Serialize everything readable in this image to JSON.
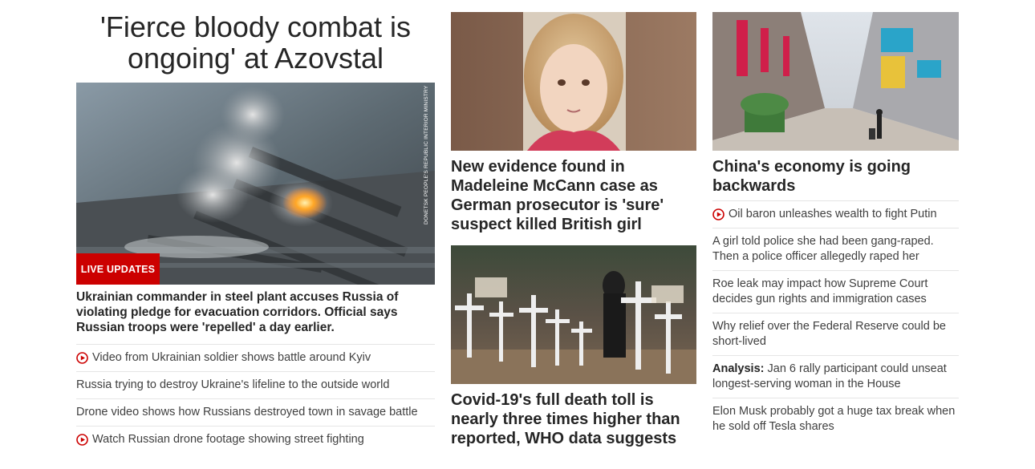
{
  "lead": {
    "title": "'Fierce bloody combat is ongoing' at Azovstal",
    "badge": "LIVE UPDATES",
    "image_credit": "DONETSK PEOPLE'S REPUBLIC INTERIOR MINISTRY",
    "subheadline": "Ukrainian commander in steel plant accuses Russia of violating pledge for evacuation corridors. Official says Russian troops were 'repelled' a day earlier.",
    "links": [
      {
        "text": "Video from Ukrainian soldier shows battle around Kyiv",
        "icon": "play-icon"
      },
      {
        "text": "Russia trying to destroy Ukraine's lifeline to the outside world",
        "icon": ""
      },
      {
        "text": "Drone video shows how Russians destroyed town in savage battle",
        "icon": ""
      },
      {
        "text": "Watch Russian drone footage showing street fighting",
        "icon": "play-icon"
      }
    ]
  },
  "middle": {
    "story1": {
      "headline": "New evidence found in Madeleine McCann case as German prosecutor is 'sure' suspect killed British girl"
    },
    "story2": {
      "headline": "Covid-19's full death toll is nearly three times higher than reported, WHO data suggests"
    }
  },
  "right": {
    "headline": "China's economy is going backwards",
    "links": [
      {
        "label": "",
        "text": "Oil baron unleashes wealth to fight Putin",
        "icon": "play-icon"
      },
      {
        "label": "",
        "text": "A girl told police she had been gang-raped. Then a police officer allegedly raped her",
        "icon": ""
      },
      {
        "label": "",
        "text": "Roe leak may impact how Supreme Court decides gun rights and immigration cases",
        "icon": ""
      },
      {
        "label": "",
        "text": "Why relief over the Federal Reserve could be short-lived",
        "icon": ""
      },
      {
        "label": "Analysis:",
        "text": "Jan 6 rally participant could unseat longest-serving woman in the House",
        "icon": ""
      },
      {
        "label": "",
        "text": "Elon Musk probably got a huge tax break when he sold off Tesla shares",
        "icon": ""
      }
    ]
  },
  "colors": {
    "accent_red": "#cc0000",
    "text": "#262626",
    "divider": "#e5e5e5"
  }
}
